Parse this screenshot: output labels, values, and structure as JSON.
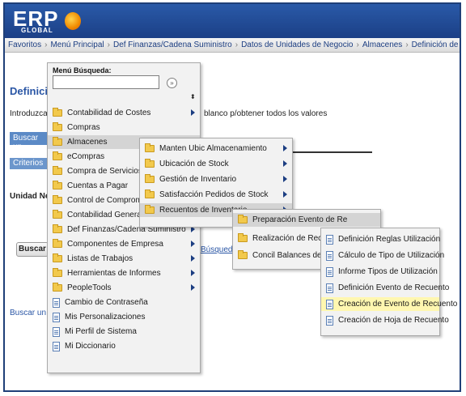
{
  "header": {
    "logo_text": "ERP",
    "logo_sub": "GLOBAL"
  },
  "breadcrumb": [
    "Favoritos",
    "Menú Principal",
    "Def Finanzas/Cadena Suministro",
    "Datos de Unidades de Negocio",
    "Almacenes",
    "Definición de Almacenes"
  ],
  "page": {
    "title": "Definición",
    "instructions": "Introduzca V",
    "instructions_tail": "blanco p/obtener todos los valores",
    "search_tab": "Buscar un",
    "criteria": "Criterios",
    "unidad_label": "Unidad Ne",
    "buscar_button": "Buscar",
    "busqueda_link": "Búsqued",
    "buscar_link2": "Buscar un V"
  },
  "menu_main": {
    "heading": "Menú Búsqueda:",
    "go_icon": "go-arrow-icon",
    "items": [
      {
        "label": "Contabilidad de Costes",
        "icon": "folder"
      },
      {
        "label": "Compras",
        "icon": "folder"
      },
      {
        "label": "Almacenes",
        "icon": "folder"
      },
      {
        "label": "eCompras",
        "icon": "folder"
      },
      {
        "label": "Compra de Servicios",
        "icon": "folder"
      },
      {
        "label": "Cuentas a Pagar",
        "icon": "folder"
      },
      {
        "label": "Control de Compromisos",
        "icon": "folder"
      },
      {
        "label": "Contabilidad General",
        "icon": "folder"
      },
      {
        "label": "Def Finanzas/Cadena Suministro",
        "icon": "folder"
      },
      {
        "label": "Componentes de Empresa",
        "icon": "folder"
      },
      {
        "label": "Listas de Trabajos",
        "icon": "folder"
      },
      {
        "label": "Herramientas de Informes",
        "icon": "folder"
      },
      {
        "label": "PeopleTools",
        "icon": "folder"
      },
      {
        "label": "Cambio de Contraseña",
        "icon": "doc"
      },
      {
        "label": "Mis Personalizaciones",
        "icon": "doc"
      },
      {
        "label": "Mi Perfil de Sistema",
        "icon": "doc"
      },
      {
        "label": "Mi Diccionario",
        "icon": "doc"
      }
    ]
  },
  "menu_almacenes": {
    "items": [
      {
        "label": "Manten Ubic Almacenamiento"
      },
      {
        "label": "Ubicación de Stock"
      },
      {
        "label": "Gestión de Inventario"
      },
      {
        "label": "Satisfacción Pedidos de Stock"
      },
      {
        "label": "Recuentos de Inventario"
      }
    ]
  },
  "menu_recuentos": {
    "items": [
      {
        "label": "Preparación Evento de Re"
      },
      {
        "label": "Realización de Recuento"
      },
      {
        "label": "Concil Balances de Inventa"
      }
    ]
  },
  "menu_preparacion": {
    "items": [
      {
        "label": "Definición Reglas Utilización"
      },
      {
        "label": "Cálculo de Tipo de Utilización"
      },
      {
        "label": "Informe Tipos de Utilización"
      },
      {
        "label": "Definición Evento de Recuento"
      },
      {
        "label": "Creación de Evento de Recuento"
      },
      {
        "label": "Creación de Hoja de Recuento"
      }
    ]
  },
  "colors": {
    "header_blue": "#1b3f86",
    "link_blue": "#2a56a5",
    "hover_yellow": "#fff7b0",
    "folder_yellow": "#f2c94c"
  }
}
